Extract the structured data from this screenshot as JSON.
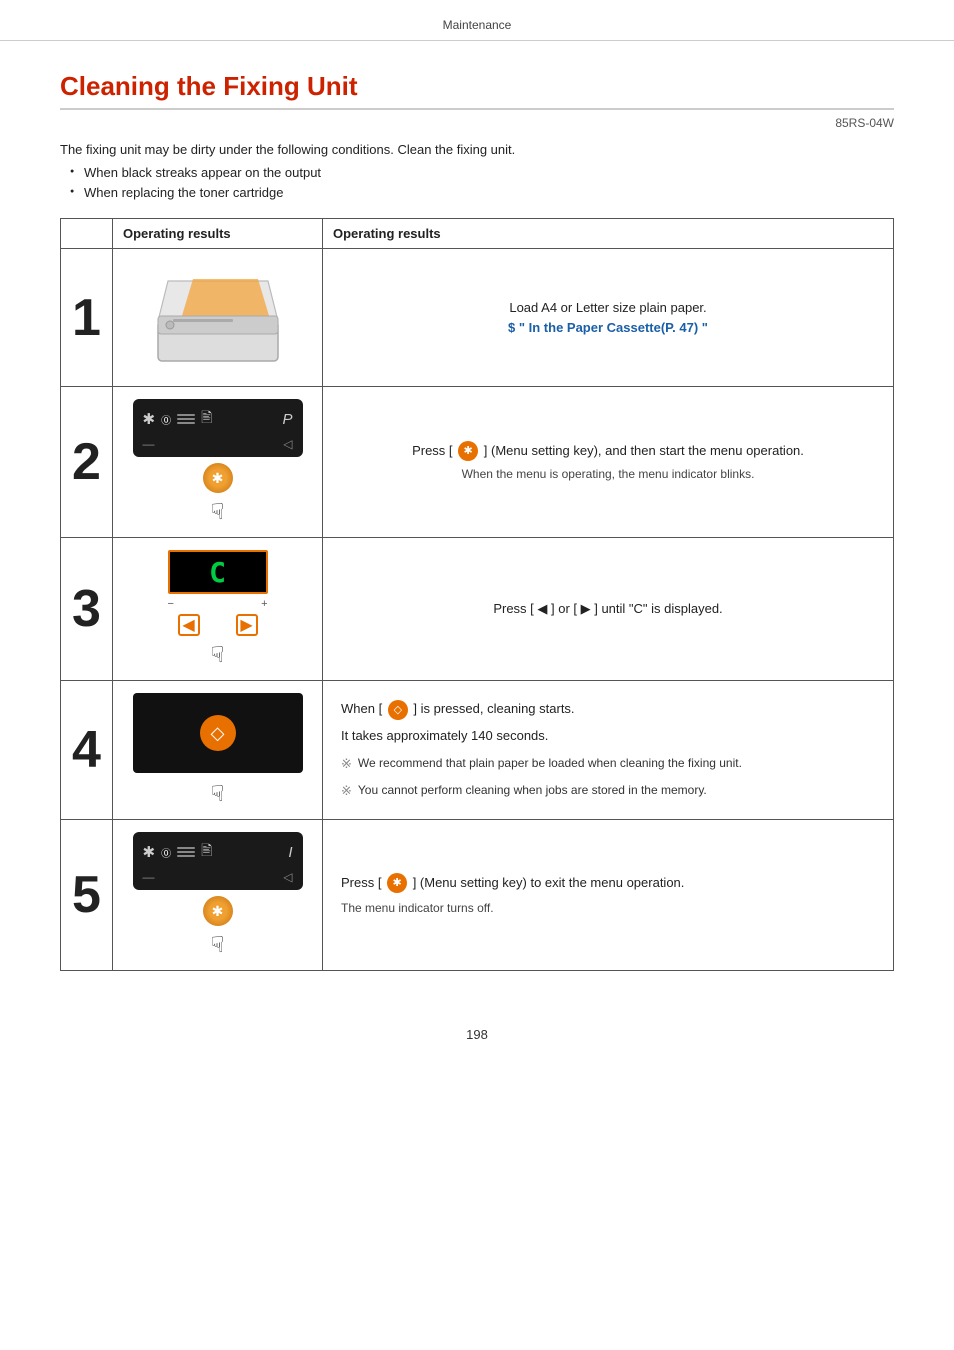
{
  "header": {
    "label": "Maintenance"
  },
  "title": "Cleaning the Fixing Unit",
  "doc_id": "85RS-04W",
  "intro": "The fixing unit may be dirty under the following conditions. Clean the fixing unit.",
  "bullets": [
    "When black streaks appear on the output",
    "When replacing the toner cartridge"
  ],
  "table": {
    "col1_header": "Operating results",
    "col2_header": "Operating results",
    "steps": [
      {
        "num": "1",
        "desc_line1": "Load A4 or Letter size plain paper.",
        "desc_link": "\" In the Paper Cassette(P. 47) \"",
        "desc_link_prefix": ""
      },
      {
        "num": "2",
        "desc_line1": "Press [  ] (Menu setting key), and then start the menu operation.",
        "desc_line2": "When the menu is operating, the menu indicator blinks."
      },
      {
        "num": "3",
        "desc_line1": "Press [ ◀ ] or [ ▶ ] until \"C\" is displayed."
      },
      {
        "num": "4",
        "desc_line1": "When [  ] is pressed, cleaning starts.",
        "desc_line2": "It takes approximately 140 seconds.",
        "note1": "We recommend that plain paper be loaded when cleaning the fixing unit.",
        "note2": "You cannot perform cleaning when jobs are stored in the memory."
      },
      {
        "num": "5",
        "desc_line1": "Press [  ] (Menu setting key) to exit the menu operation.",
        "desc_line2": "The menu indicator turns off."
      }
    ]
  },
  "footer": {
    "page_number": "198"
  },
  "icons": {
    "menu_icon": "☆",
    "ok_icon": "◇",
    "gear_icon": "✱",
    "note_sym": "※",
    "left_arrow": "◀",
    "right_arrow": "▶",
    "hand": "☞",
    "link_text": "\" In the Paper Cassette(P. 47) \""
  }
}
